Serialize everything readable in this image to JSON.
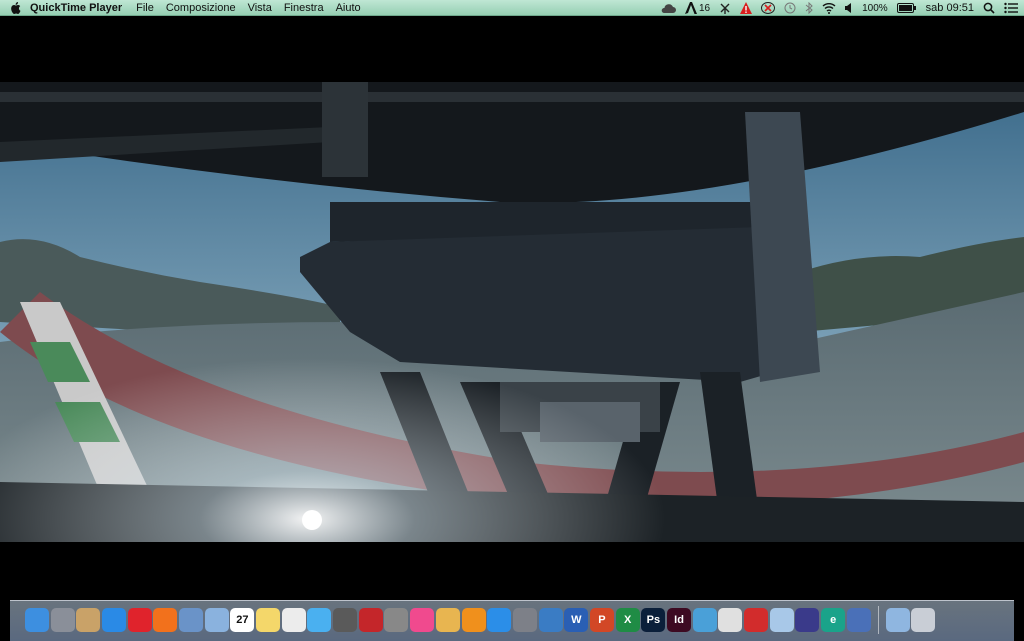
{
  "menubar": {
    "app_name": "QuickTime Player",
    "items": [
      "File",
      "Composizione",
      "Vista",
      "Finestra",
      "Aiuto"
    ],
    "status": {
      "adobe_count": "16",
      "battery_percent": "100%",
      "clock": "sab 09:51"
    }
  },
  "video": {
    "description_icons": []
  },
  "dock": {
    "apps": [
      {
        "icon": "finder-icon",
        "color": "#3d8fe0"
      },
      {
        "icon": "rocket-icon",
        "color": "#8a8f99"
      },
      {
        "icon": "contacts-icon",
        "color": "#c9a268"
      },
      {
        "icon": "safari-icon",
        "color": "#2a8ae6"
      },
      {
        "icon": "opera-icon",
        "color": "#e0232c"
      },
      {
        "icon": "firefox-icon",
        "color": "#f2711c"
      },
      {
        "icon": "preview-icon",
        "color": "#6a93c8"
      },
      {
        "icon": "mail-icon",
        "color": "#8ab2de"
      },
      {
        "icon": "calendar-icon",
        "color": "#ffffff",
        "label": "27"
      },
      {
        "icon": "notes-icon",
        "color": "#f4d76a"
      },
      {
        "icon": "reminders-icon",
        "color": "#ececec"
      },
      {
        "icon": "messages-icon",
        "color": "#4ab0f0"
      },
      {
        "icon": "facetime-icon",
        "color": "#5a5a5a"
      },
      {
        "icon": "photo-booth-icon",
        "color": "#c4262a"
      },
      {
        "icon": "photos-icon",
        "color": "#888888"
      },
      {
        "icon": "itunes-icon",
        "color": "#f04a8e"
      },
      {
        "icon": "text-edit-icon",
        "color": "#e8b550"
      },
      {
        "icon": "ibooks-icon",
        "color": "#f0901c"
      },
      {
        "icon": "app-store-icon",
        "color": "#2b8ee8"
      },
      {
        "icon": "system-preferences-icon",
        "color": "#7d8088"
      },
      {
        "icon": "screen-sharing-icon",
        "color": "#3a7cc4"
      },
      {
        "icon": "word-icon",
        "color": "#2a5fb4",
        "label": "W"
      },
      {
        "icon": "powerpoint-icon",
        "color": "#d24726",
        "label": "P"
      },
      {
        "icon": "excel-icon",
        "color": "#1f8c45",
        "label": "X"
      },
      {
        "icon": "photoshop-icon",
        "color": "#0b1f3a",
        "label": "Ps"
      },
      {
        "icon": "indesign-icon",
        "color": "#3d0a22",
        "label": "Id"
      },
      {
        "icon": "downloader-icon",
        "color": "#4aa0d8"
      },
      {
        "icon": "script-editor-icon",
        "color": "#e0e0e0"
      },
      {
        "icon": "web-icon",
        "color": "#d22c2c"
      },
      {
        "icon": "sync-icon",
        "color": "#a8c8e8"
      },
      {
        "icon": "imovie-icon",
        "color": "#3a3a8a"
      },
      {
        "icon": "eset-icon",
        "color": "#1aa38a",
        "label": "e"
      },
      {
        "icon": "network-icon",
        "color": "#4a70b8"
      },
      {
        "icon": "downloads-folder-icon",
        "color": "#8fb6e0"
      },
      {
        "icon": "trash-icon",
        "color": "#c9ced6"
      }
    ]
  }
}
